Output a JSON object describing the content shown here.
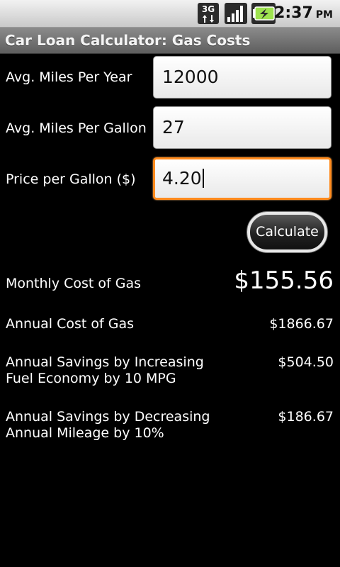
{
  "status_bar": {
    "network": "3G",
    "time": "2:37",
    "ampm": "PM",
    "icons": [
      "3g-data-icon",
      "signal-strength-icon",
      "battery-charging-icon"
    ]
  },
  "title_bar": {
    "title": "Car Loan Calculator: Gas Costs"
  },
  "form": {
    "miles_per_year": {
      "label": "Avg. Miles Per Year",
      "value": "12000"
    },
    "miles_per_gallon": {
      "label": "Avg. Miles Per Gallon",
      "value": "27"
    },
    "price_per_gallon": {
      "label": "Price per Gallon ($)",
      "value": "4.20"
    },
    "calculate_label": "Calculate"
  },
  "results": {
    "monthly": {
      "label": "Monthly Cost of Gas",
      "value": "$155.56"
    },
    "annual": {
      "label": "Annual Cost of Gas",
      "value": "$1866.67"
    },
    "savings_mpg": {
      "label_line1": "Annual Savings by Increasing",
      "label_line2": "Fuel Economy by 10 MPG",
      "value": "$504.50"
    },
    "savings_mileage": {
      "label_line1": "Annual Savings by Decreasing",
      "label_line2": "Annual Mileage by 10%",
      "value": "$186.67"
    }
  },
  "colors": {
    "background": "#000000",
    "focus_border": "#ff8a1c",
    "title_bar": "#6e6e6e",
    "status_bar": "#d9d9d9"
  }
}
